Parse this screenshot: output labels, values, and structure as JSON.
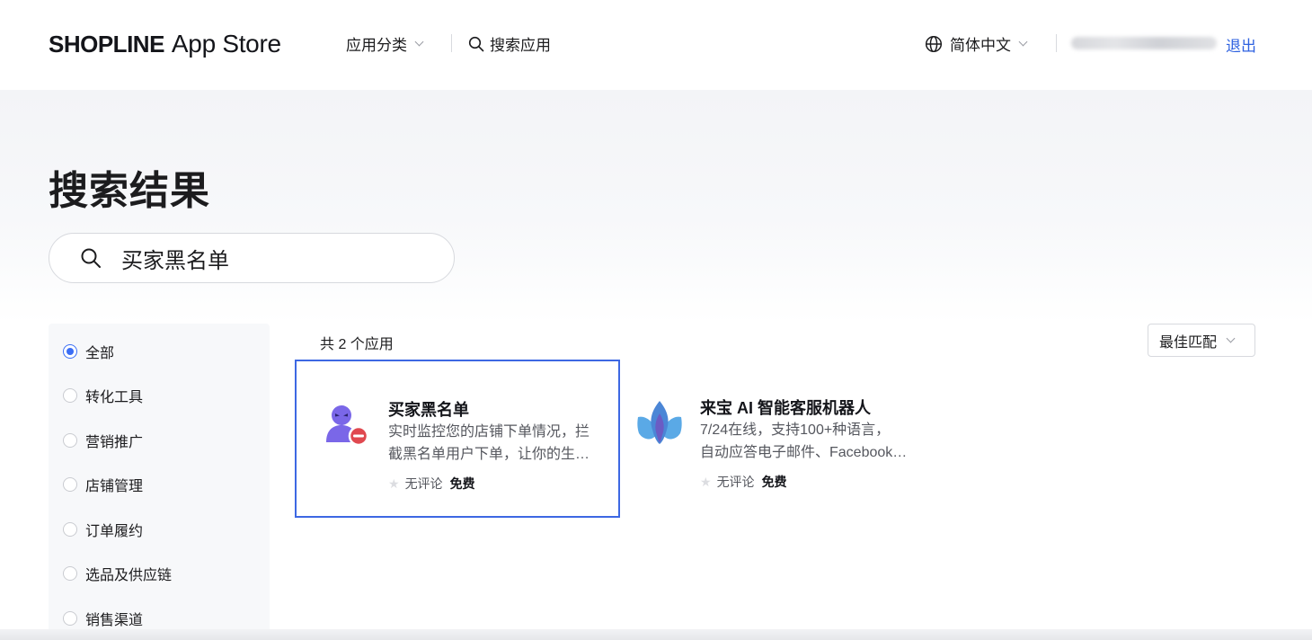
{
  "header": {
    "logo_brand": "SHOPLINE",
    "logo_store": "App Store",
    "nav_categories": "应用分类",
    "nav_search": "搜索应用",
    "language": "简体中文",
    "logout": "退出"
  },
  "page": {
    "title": "搜索结果",
    "search_value": "买家黑名单"
  },
  "sidebar": {
    "items": [
      {
        "label": "全部",
        "selected": true
      },
      {
        "label": "转化工具",
        "selected": false
      },
      {
        "label": "营销推广",
        "selected": false
      },
      {
        "label": "店铺管理",
        "selected": false
      },
      {
        "label": "订单履约",
        "selected": false
      },
      {
        "label": "选品及供应链",
        "selected": false
      },
      {
        "label": "销售渠道",
        "selected": false
      }
    ]
  },
  "results": {
    "count_text": "共 2 个应用",
    "sort_label": "最佳匹配",
    "apps": [
      {
        "name": "买家黑名单",
        "desc_line1": "实时监控您的店铺下单情况，拦",
        "desc_line2": "截黑名单用户下单，让你的生…",
        "review": "无评论",
        "price": "免费",
        "icon": "blocked-user-icon",
        "selected": true
      },
      {
        "name": "来宝 AI 智能客服机器人",
        "desc_line1": "7/24在线，支持100+种语言，",
        "desc_line2": "自动应答电子邮件、Facebook…",
        "review": "无评论",
        "price": "免费",
        "icon": "lotus-logo-icon",
        "selected": false
      }
    ]
  },
  "colors": {
    "accent": "#3b6ef5",
    "selected_border": "#3d68e3",
    "logout_link": "#2f62e0"
  }
}
